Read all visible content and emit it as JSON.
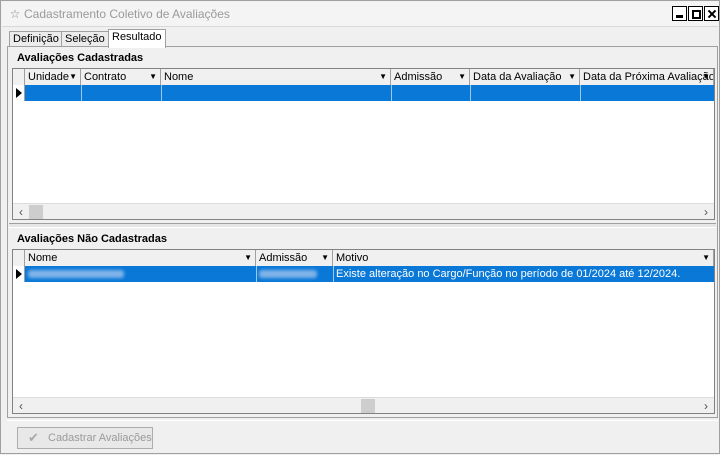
{
  "window": {
    "title": "Cadastramento Coletivo de Avaliações"
  },
  "tabs": [
    {
      "label": "Definição"
    },
    {
      "label": "Seleção"
    },
    {
      "label": "Resultado"
    }
  ],
  "cadastradas": {
    "title": "Avaliações Cadastradas",
    "columns": [
      "Unidade",
      "Contrato",
      "Nome",
      "Admissão",
      "Data da Avaliação",
      "Data da Próxima Avaliação"
    ]
  },
  "nao_cadastradas": {
    "title": "Avaliações Não Cadastradas",
    "columns": [
      "Nome",
      "Admissão",
      "Motivo"
    ],
    "rows": [
      {
        "motivo": "Existe alteração no Cargo/Função no período de 01/2024 até 12/2024."
      }
    ]
  },
  "actions": {
    "cadastrar_label": "Cadastrar Avaliações"
  }
}
